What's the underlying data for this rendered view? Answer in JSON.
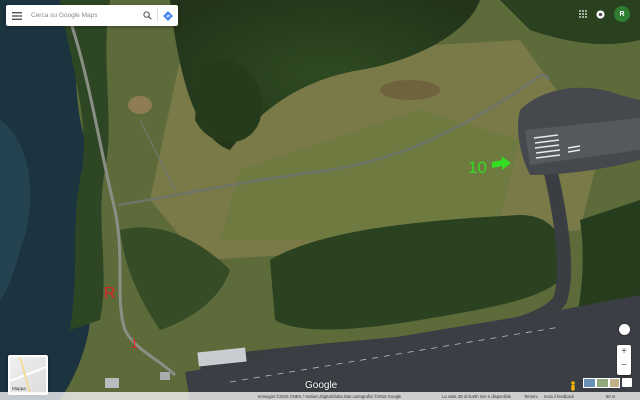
{
  "search": {
    "placeholder": "Cerca su Google Maps"
  },
  "annotations": {
    "marker_10": "10",
    "marker_r": "R",
    "marker_1": "1"
  },
  "layer_toggle": {
    "label": "Mappa"
  },
  "branding": {
    "google": "Google"
  },
  "account": {
    "initial": "R"
  },
  "footer": {
    "imagery": "Immagini ©2016 CNES / Astrium,DigitalGlobe,Dati cartografici ©2016 Google",
    "earth_notice": "La vista 3D di Earth non è disponibile",
    "terms": "Termini",
    "feedback": "Invia il feedback",
    "scale": "50 m"
  },
  "colors": {
    "annotation_green": "#33dd22",
    "annotation_red": "#e02020",
    "account": "#2e7d32",
    "directions": "#4285f4"
  }
}
